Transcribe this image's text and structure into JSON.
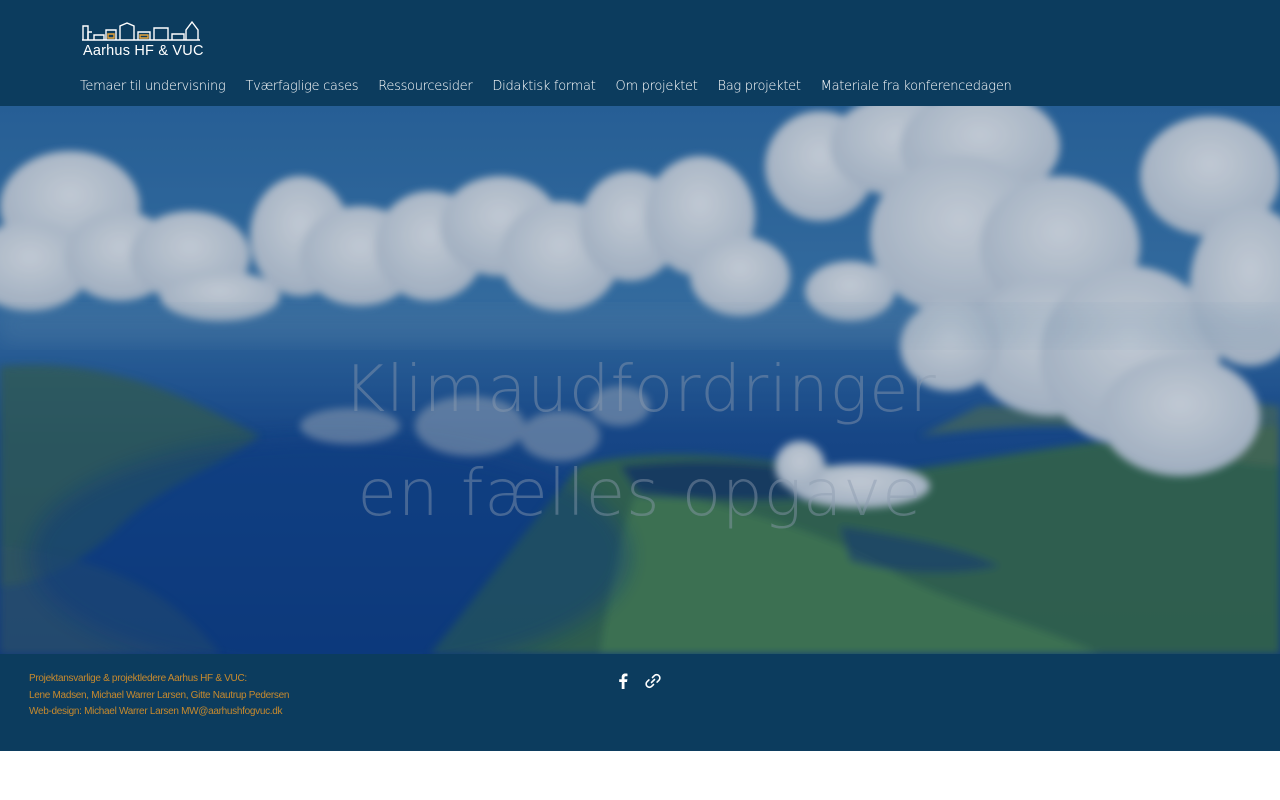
{
  "header": {
    "logo_text": "Aarhus HF & VUC",
    "nav": [
      {
        "label": "Temaer til undervisning"
      },
      {
        "label": "Tværfaglige cases"
      },
      {
        "label": "Ressourcesider"
      },
      {
        "label": "Didaktisk format"
      },
      {
        "label": "Om projektet"
      },
      {
        "label": "Bag projektet"
      },
      {
        "label": "Materiale fra konferencedagen"
      }
    ]
  },
  "hero": {
    "title_line1": "Klimaudfordringer",
    "title_line2": "en fælles opgave"
  },
  "footer": {
    "line1": "Projektansvarlige & projektledere Aarhus HF & VUC:",
    "line2": "Lene Madsen, Michael Warrer Larsen, Gitte Nautrup Pedersen",
    "line3": "Web-design: Michael Warrer Larsen MW@aarhushfogvuc.dk",
    "social": [
      {
        "icon": "facebook-icon"
      },
      {
        "icon": "link-icon"
      }
    ]
  },
  "colors": {
    "header_bg": "#0c3c5e",
    "footer_bg": "#0c3c5e",
    "footer_text": "#c88a2d",
    "logo_accent": "#e8a33a"
  }
}
